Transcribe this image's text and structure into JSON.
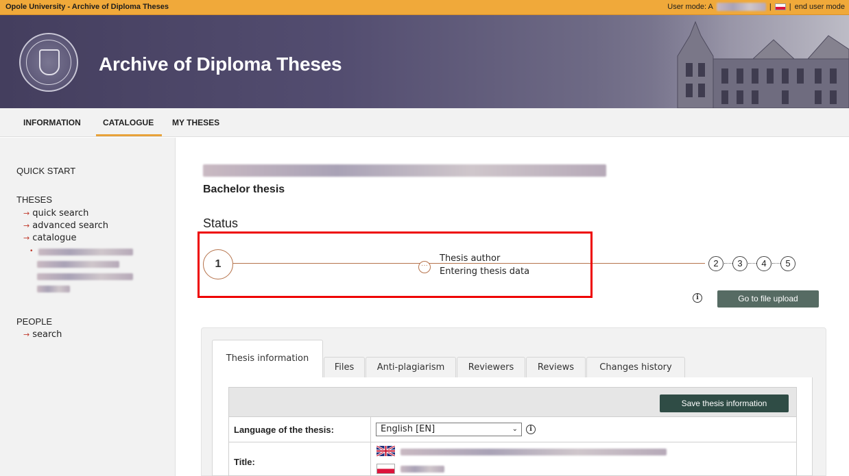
{
  "topbar": {
    "site": "Opole University - Archive of Diploma Theses",
    "user_mode_label": "User mode: A",
    "separator": "|",
    "end_user_mode": "end user mode"
  },
  "header": {
    "title": "Archive of Diploma Theses"
  },
  "nav": {
    "items": [
      {
        "label": "INFORMATION"
      },
      {
        "label": "CATALOGUE",
        "active": true
      },
      {
        "label": "MY THESES"
      }
    ]
  },
  "sidebar": {
    "quick_start": "QUICK START",
    "theses": "THESES",
    "theses_links": [
      "quick search",
      "advanced search",
      "catalogue"
    ],
    "people": "PEOPLE",
    "people_links": [
      "search"
    ],
    "arrow": "→",
    "bullet": "•"
  },
  "thesis": {
    "type": "Bachelor thesis"
  },
  "status": {
    "heading": "Status",
    "current_step": "1",
    "dots": "···",
    "role": "Thesis author",
    "action": "Entering thesis data",
    "next_steps": [
      "2",
      "3",
      "4",
      "5"
    ],
    "upload_button": "Go to file upload",
    "info": "i"
  },
  "tabs": [
    "Thesis information",
    "Files",
    "Anti-plagiarism",
    "Reviewers",
    "Reviews",
    "Changes history"
  ],
  "form": {
    "save_button": "Save thesis information",
    "language_label": "Language of the thesis:",
    "language_value": "English [EN]",
    "title_label": "Title:"
  },
  "colors": {
    "accent": "#f0a93a",
    "banner": "#443e5e",
    "step_line": "#b5724a",
    "button": "#566b63",
    "highlight": "#ee0000"
  }
}
